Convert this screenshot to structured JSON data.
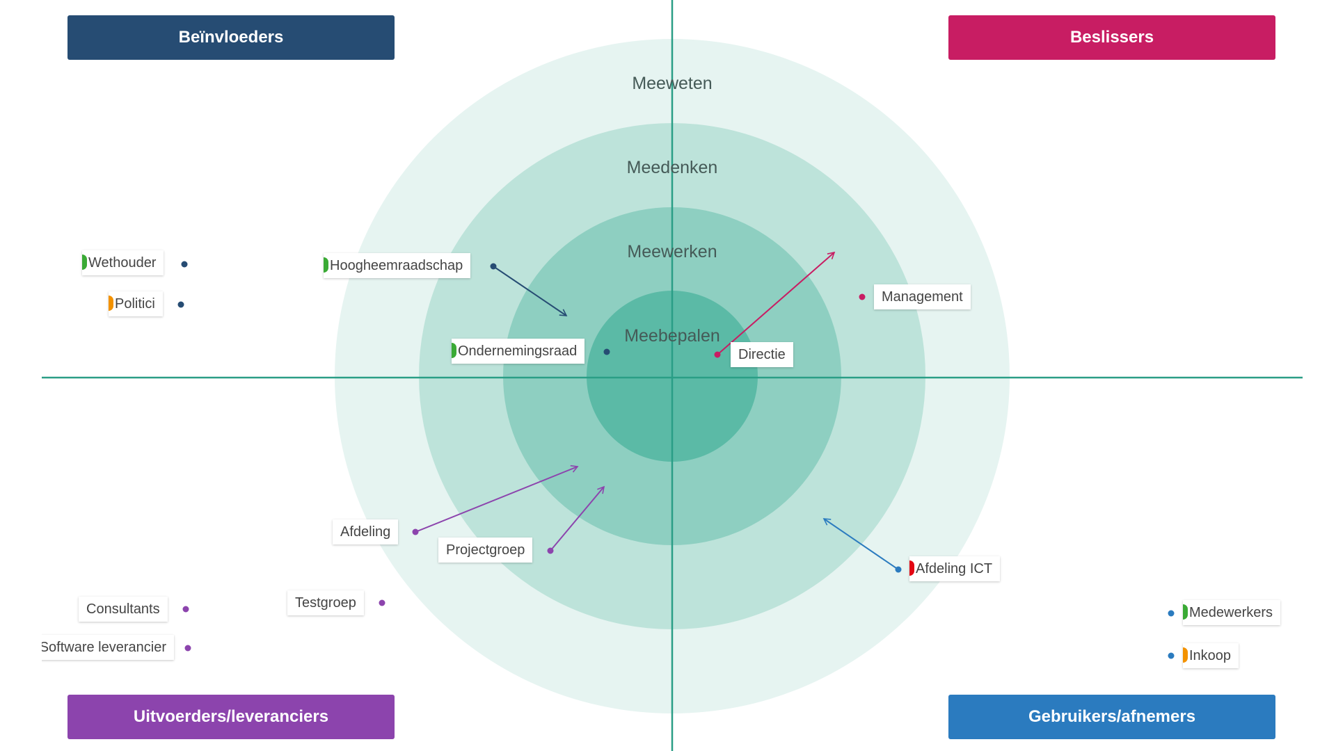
{
  "quadrants": {
    "top_left": {
      "title": "Beïnvloeders",
      "color": "#264c73"
    },
    "top_right": {
      "title": "Beslissers",
      "color": "#c81d63"
    },
    "bottom_left": {
      "title": "Uitvoerders/leveranciers",
      "color": "#8c44ad"
    },
    "bottom_right": {
      "title": "Gebruikers/afnemers",
      "color": "#2b7bbf"
    }
  },
  "rings": {
    "outer": "Meeweten",
    "second": "Meedenken",
    "third": "Meewerken",
    "inner": "Meebepalen"
  },
  "colors": {
    "ring_outer": "#e6f4f1",
    "ring_second": "#bde3da",
    "ring_third": "#8ecfc1",
    "ring_inner": "#5bbaa6",
    "axis": "#2a9e86",
    "indicator_green": "#3aaa35",
    "indicator_orange": "#f39200",
    "indicator_red": "#e30613"
  },
  "stakeholders": {
    "wethouder": {
      "label": "Wethouder",
      "indicator": "green"
    },
    "politici": {
      "label": "Politici",
      "indicator": "orange"
    },
    "hoogheemraadschap": {
      "label": "Hoogheemraadschap",
      "indicator": "green"
    },
    "ondernemingsraad": {
      "label": "Ondernemingsraad",
      "indicator": "green"
    },
    "directie": {
      "label": "Directie"
    },
    "management": {
      "label": "Management"
    },
    "afdeling": {
      "label": "Afdeling"
    },
    "projectgroep": {
      "label": "Projectgroep"
    },
    "testgroep": {
      "label": "Testgroep"
    },
    "consultants": {
      "label": "Consultants"
    },
    "software_leverancier": {
      "label": "Software leverancier"
    },
    "afdeling_ict": {
      "label": "Afdeling ICT",
      "indicator": "red"
    },
    "medewerkers": {
      "label": "Medewerkers",
      "indicator": "green"
    },
    "inkoop": {
      "label": "Inkoop",
      "indicator": "orange"
    }
  }
}
